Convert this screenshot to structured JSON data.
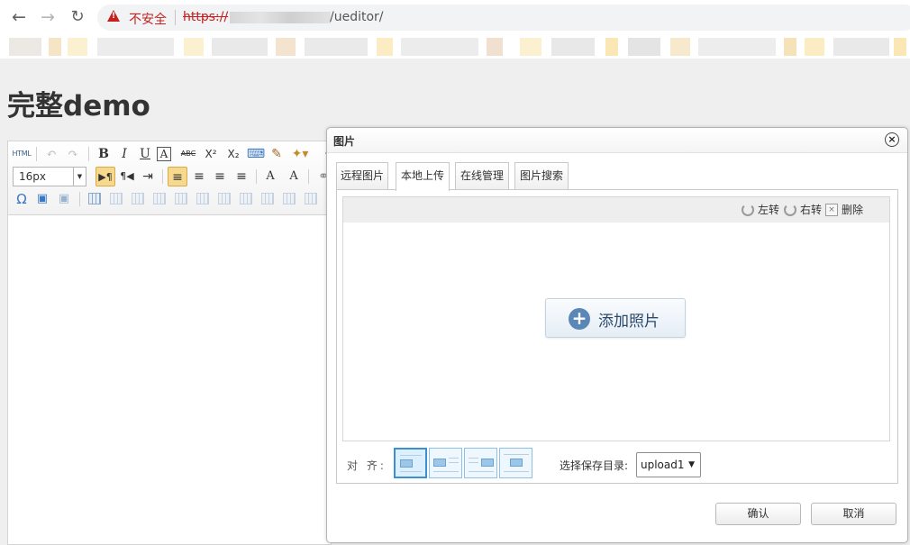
{
  "browser": {
    "insecure_label": "不安全",
    "url_scheme": "https://",
    "url_path": "/ueditor/"
  },
  "page": {
    "title": "完整demo"
  },
  "editor": {
    "toolbar": {
      "html_label": "HTML",
      "bold": "B",
      "italic": "I",
      "underline": "U",
      "font_border": "A",
      "strikethrough": "ABC",
      "superscript": "X²",
      "subscript": "X₂",
      "font_size": "16px"
    }
  },
  "dialog": {
    "title": "图片",
    "tabs": [
      {
        "label": "远程图片"
      },
      {
        "label": "本地上传"
      },
      {
        "label": "在线管理"
      },
      {
        "label": "图片搜索"
      }
    ],
    "active_tab": "本地上传",
    "queue_actions": {
      "rotate_left": "左转",
      "rotate_right": "右转",
      "delete": "删除"
    },
    "add_photo_label": "添加照片",
    "align_label": "对 齐:",
    "save_dir_label": "选择保存目录:",
    "save_dir_value": "upload1",
    "confirm_label": "确认",
    "cancel_label": "取消"
  },
  "colors": {
    "insecure_red": "#c5221f",
    "active_tab_border": "#c9c9c9",
    "add_button_accent": "#5b87b7",
    "align_selected": "#3d8fcf"
  }
}
